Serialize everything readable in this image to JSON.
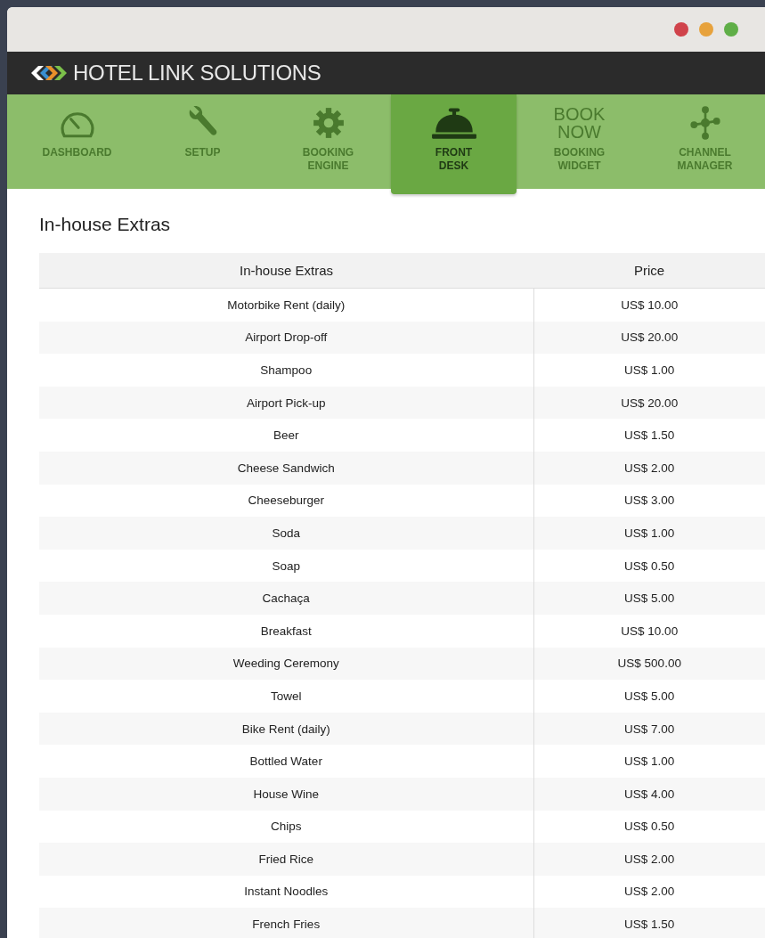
{
  "app": {
    "title": "HOTEL LINK SOLUTIONS"
  },
  "tabs": [
    {
      "label": "DASHBOARD",
      "kind": "gauge",
      "selected": false
    },
    {
      "label": "SETUP",
      "kind": "wrench",
      "selected": false
    },
    {
      "label": "BOOKING ENGINE",
      "kind": "gear",
      "selected": false
    },
    {
      "label": "FRONT DESK",
      "kind": "bell",
      "selected": true
    },
    {
      "label": "BOOKING WIDGET",
      "kind": "text",
      "icon_text": "BOOK NOW",
      "selected": false
    },
    {
      "label": "CHANNEL MANAGER",
      "kind": "network",
      "selected": false
    }
  ],
  "page": {
    "title": "In-house Extras"
  },
  "table": {
    "columns": [
      "In-house Extras",
      "Price"
    ],
    "rows": [
      [
        "Motorbike Rent (daily)",
        "US$ 10.00"
      ],
      [
        "Airport Drop-off",
        "US$ 20.00"
      ],
      [
        "Shampoo",
        "US$ 1.00"
      ],
      [
        "Airport Pick-up",
        "US$ 20.00"
      ],
      [
        "Beer",
        "US$ 1.50"
      ],
      [
        "Cheese Sandwich",
        "US$ 2.00"
      ],
      [
        "Cheeseburger",
        "US$ 3.00"
      ],
      [
        "Soda",
        "US$ 1.00"
      ],
      [
        "Soap",
        "US$ 0.50"
      ],
      [
        "Cachaça",
        "US$ 5.00"
      ],
      [
        "Breakfast",
        "US$ 10.00"
      ],
      [
        "Weeding Ceremony",
        "US$ 500.00"
      ],
      [
        "Towel",
        "US$ 5.00"
      ],
      [
        "Bike Rent (daily)",
        "US$ 7.00"
      ],
      [
        "Bottled Water",
        "US$ 1.00"
      ],
      [
        "House Wine",
        "US$ 4.00"
      ],
      [
        "Chips",
        "US$ 0.50"
      ],
      [
        "Fried Rice",
        "US$ 2.00"
      ],
      [
        "Instant Noodles",
        "US$ 2.00"
      ],
      [
        "French Fries",
        "US$ 1.50"
      ]
    ]
  }
}
